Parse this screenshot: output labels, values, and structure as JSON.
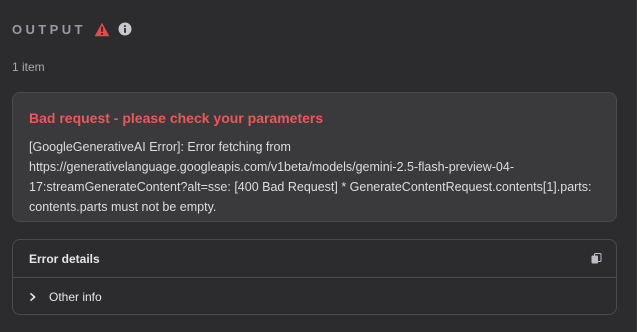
{
  "output": {
    "title": "OUTPUT",
    "warning_icon": "warning-triangle-icon",
    "info_icon": "info-circle-icon",
    "item_count": "1 item"
  },
  "error": {
    "title": "Bad request - please check your parameters",
    "message": "[GoogleGenerativeAI Error]: Error fetching from https://generativelanguage.googleapis.com/v1beta/models/gemini-2.5-flash-preview-04-17:streamGenerateContent?alt=sse: [400 Bad Request] * GenerateContentRequest.contents[1].parts: contents.parts must not be empty."
  },
  "details": {
    "title": "Error details",
    "copy_icon": "copy-icon",
    "other_info_label": "Other info",
    "expand_icon": "chevron-right-icon"
  },
  "colors": {
    "background": "#2c2c2e",
    "card": "#3a3a3c",
    "error_red": "#f0555b",
    "warning_red": "#e5484d",
    "muted_text": "#9a9aa0"
  }
}
